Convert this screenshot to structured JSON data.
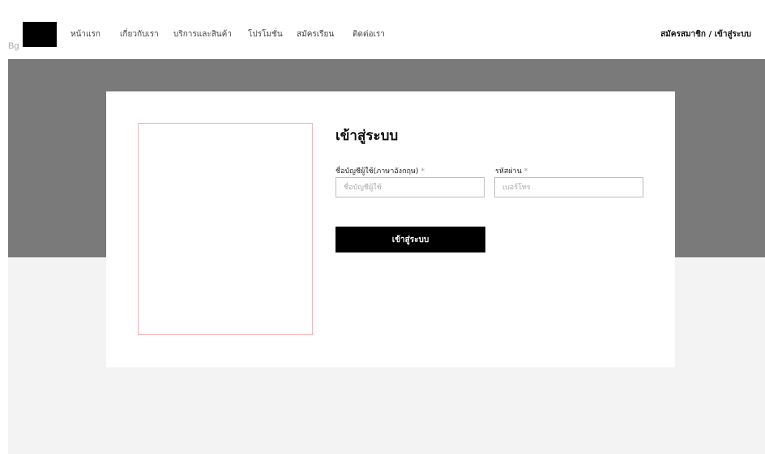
{
  "header": {
    "bg_label": "Bg",
    "nav": [
      {
        "label": "หน้าแรก"
      },
      {
        "label": "เกี่ยวกับเรา"
      },
      {
        "label": "บริการและสินค้า"
      },
      {
        "label": "โปรโมชั่น"
      },
      {
        "label": "สมัครเรียน"
      },
      {
        "label": "ติดต่อเรา"
      }
    ],
    "auth_link": "สมัครสมาชิก / เข้าสู่ระบบ"
  },
  "login": {
    "title": "เข้าสู่ระบบ",
    "username": {
      "label": "ชื่อบัญชีผู้ใช้(ภาษาอังกฤษ)",
      "required_mark": "*",
      "placeholder": "ชื่อบัญชีผู้ใช้",
      "value": ""
    },
    "password": {
      "label": "รหัสผ่าน",
      "required_mark": "*",
      "placeholder": "เบอร์โทร",
      "value": ""
    },
    "submit_label": "เข้าสู่ระบบ"
  },
  "colors": {
    "page_bg": "#f3f3f3",
    "header_bg": "#ffffff",
    "hero_bg": "#7a7a7a",
    "button_bg": "#000000",
    "image_border": "#f2b8b8"
  }
}
